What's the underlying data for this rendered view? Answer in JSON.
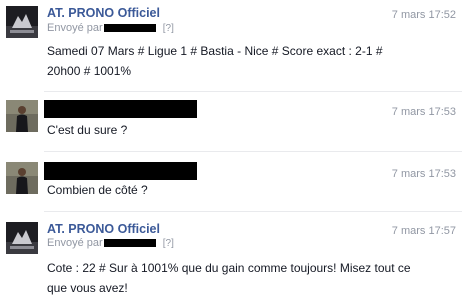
{
  "messages": [
    {
      "author": "AT. PRONO Officiel",
      "sent_by_label": "Envoyé par",
      "help_link": "[?]",
      "timestamp": "7 mars 17:52",
      "body_line1": "Samedi 07 Mars # Ligue 1 # Bastia - Nice # Score exact : 2-1 #",
      "body_line2": "20h00 # 1001%"
    },
    {
      "timestamp": "7 mars 17:53",
      "body": "C'est du sure ?"
    },
    {
      "timestamp": "7 mars 17:53",
      "body": "Combien de côté ?"
    },
    {
      "author": "AT. PRONO Officiel",
      "sent_by_label": "Envoyé par",
      "help_link": "[?]",
      "timestamp": "7 mars 17:57",
      "body_line1": "Cote : 22 # Sur à 1001% que du gain comme toujours! Misez tout ce",
      "body_line2": "que vous avez!"
    }
  ],
  "colors": {
    "author_link": "#3b5998",
    "muted_text": "#9197a3",
    "divider": "#e9eaed"
  }
}
